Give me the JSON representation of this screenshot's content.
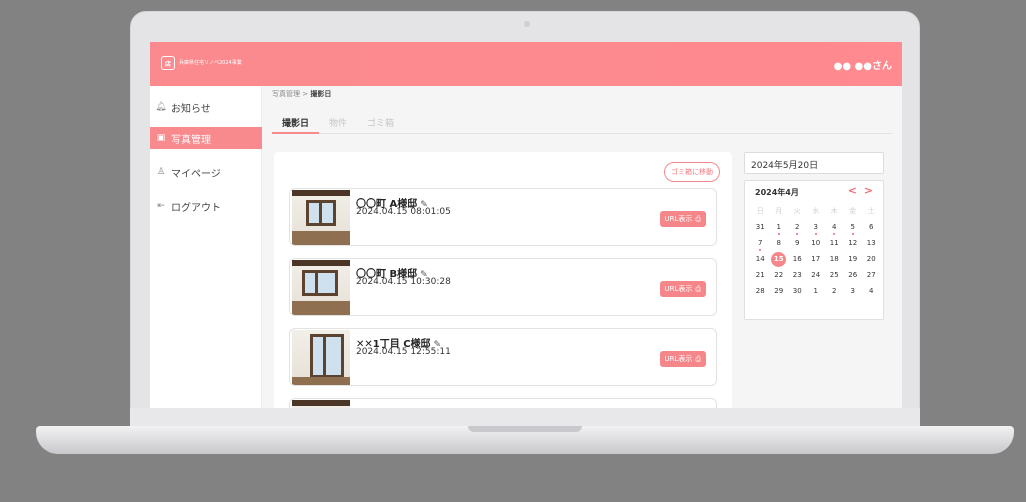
{
  "app": {
    "logo_mark": "店",
    "logo_text": "兵庫県住宅リノベ2024事業",
    "user_name": "●● ●●さん"
  },
  "sidebar": {
    "items": [
      {
        "label": "お知らせ",
        "icon": "bell-icon",
        "active": false
      },
      {
        "label": "写真管理",
        "icon": "photo-icon",
        "active": true
      },
      {
        "label": "マイページ",
        "icon": "user-icon",
        "active": false
      },
      {
        "label": "ログアウト",
        "icon": "logout-icon",
        "active": false
      }
    ]
  },
  "breadcrumb": {
    "parent": "写真管理 > ",
    "current": "撮影日"
  },
  "tabs": [
    "撮影日",
    "物件",
    "ゴミ箱"
  ],
  "toolbar": {
    "trash_label": "ゴミ箱に移動"
  },
  "photos": [
    {
      "title": "〇〇町 A様邸",
      "datetime": "2024.04.15 08:01:05",
      "url_label": "URL表示"
    },
    {
      "title": "〇〇町 B様邸",
      "datetime": "2024.04.15 10:30:28",
      "url_label": "URL表示"
    },
    {
      "title": "✕✕1丁目 C様邸",
      "datetime": "2024.04.15 12:55:11",
      "url_label": "URL表示"
    }
  ],
  "date_field": {
    "value": "2024年5月20日"
  },
  "calendar": {
    "month_label": "2024年4月",
    "prev": "<",
    "next": ">",
    "weekdays": [
      "日",
      "月",
      "火",
      "水",
      "木",
      "金",
      "土"
    ],
    "weeks": [
      [
        "31",
        "1",
        "2",
        "3",
        "4",
        "5",
        "6"
      ],
      [
        "7",
        "8",
        "9",
        "10",
        "11",
        "12",
        "13"
      ],
      [
        "14",
        "15",
        "16",
        "17",
        "18",
        "19",
        "20"
      ],
      [
        "21",
        "22",
        "23",
        "24",
        "25",
        "26",
        "27"
      ],
      [
        "28",
        "29",
        "30",
        "1",
        "2",
        "3",
        "4"
      ]
    ],
    "selected": "15",
    "dotted_days": [
      "1",
      "2",
      "3",
      "4",
      "5",
      "7"
    ],
    "accent_color": "#f5878b"
  },
  "colors": {
    "brand": "#f88a8e",
    "background": "#828282"
  }
}
